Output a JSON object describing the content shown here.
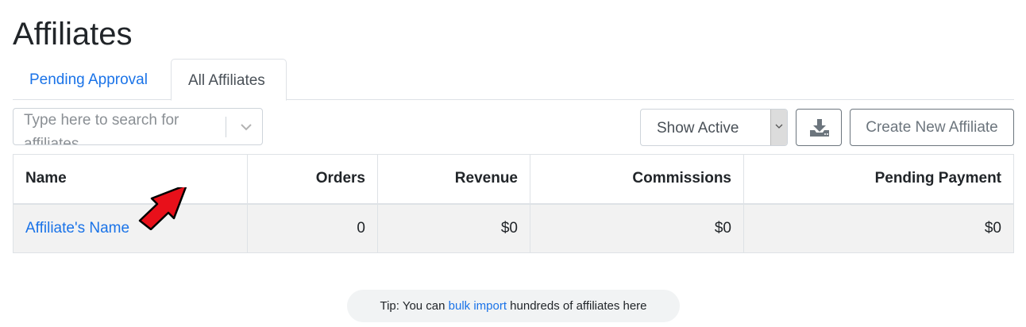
{
  "page": {
    "title": "Affiliates"
  },
  "tabs": [
    {
      "label": "Pending Approval",
      "active": false
    },
    {
      "label": "All Affiliates",
      "active": true
    }
  ],
  "search": {
    "placeholder": "Type here to search for affiliates",
    "value": "",
    "chevron_icon": "chevron-down-icon"
  },
  "filter": {
    "selected": "Show Active",
    "options": [
      "Show Active"
    ]
  },
  "toolbar": {
    "download_icon": "download-icon",
    "create_label": "Create New Affiliate"
  },
  "table": {
    "columns": [
      "Name",
      "Orders",
      "Revenue",
      "Commissions",
      "Pending Payment"
    ],
    "rows": [
      {
        "name": "Affiliate's Name",
        "orders": "0",
        "revenue": "$0",
        "commissions": "$0",
        "pending_payment": "$0"
      }
    ]
  },
  "tip": {
    "prefix": "Tip: You can ",
    "link": "bulk import",
    "suffix": " hundreds of affiliates here"
  },
  "colors": {
    "link": "#1a73e8",
    "annotation_arrow": "#e8101a",
    "row_bg": "#f2f2f2",
    "border": "#dee2e6"
  }
}
